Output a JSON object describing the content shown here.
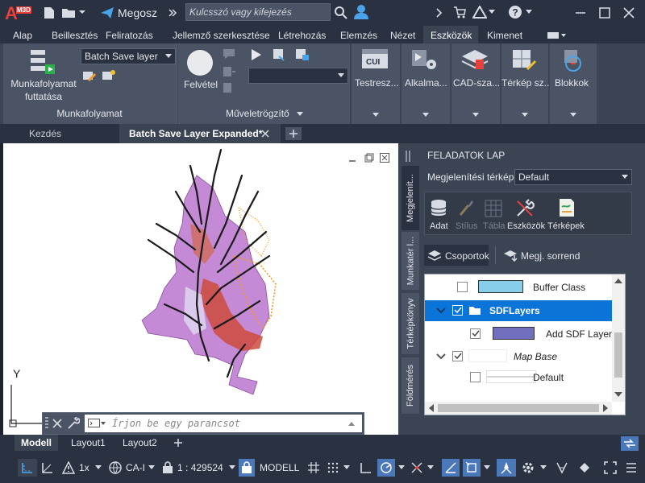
{
  "app": {
    "badge": "M3D",
    "title_letter": "A"
  },
  "titlebar": {
    "share_label": "Megosz",
    "search_placeholder": "Kulcsszó vagy kifejezés"
  },
  "ribbon_tabs": [
    {
      "label": "Alap"
    },
    {
      "label": "Beillesztés"
    },
    {
      "label": "Feliratozás"
    },
    {
      "label": "Jellemző szerkesztése"
    },
    {
      "label": "Létrehozás"
    },
    {
      "label": "Elemzés"
    },
    {
      "label": "Nézet"
    },
    {
      "label": "Eszközök",
      "active": true
    },
    {
      "label": "Kimenet"
    }
  ],
  "ribbon": {
    "workflow_run_label": "Munkafolyamat\nfuttatása",
    "workflow_select": "Batch Save layer",
    "workflow_panel": "Munkafolyamat",
    "record_label": "Felvétel",
    "recorder_panel": "Műveletrögzítő",
    "customize_label": "Testresz...",
    "cui_label": "CUI",
    "apps_label": "Alkalma...",
    "cad_label": "CAD-sza...",
    "mapsz_label": "Térkép sz...",
    "blocks_label": "Blokkok"
  },
  "doc_tabs": {
    "home": "Kezdés",
    "active": "Batch Save Layer Expanded*"
  },
  "command": {
    "placeholder": "Írjon be egy parancsot"
  },
  "axis": {
    "y_label": "Y"
  },
  "task_pane": {
    "title": "FELADATOK LAP",
    "map_label": "Megjelenítési térkép:",
    "map_value": "Default",
    "vtabs": [
      "Megjelenít...",
      "Munkatér l...",
      "Térképkönyv",
      "Földmérés"
    ],
    "tools": [
      {
        "label": "Adat",
        "enabled": true
      },
      {
        "label": "Stílus",
        "enabled": false
      },
      {
        "label": "Tábla",
        "enabled": false
      },
      {
        "label": "Eszközök",
        "enabled": true
      },
      {
        "label": "Térképek",
        "enabled": true
      }
    ],
    "groups_label": "Csoportok",
    "order_label": "Megj. sorrend",
    "layers": [
      {
        "name": "Buffer Class",
        "color": "#87ceeb",
        "checked": false
      },
      {
        "name": "SDFLayers",
        "selected": true,
        "checked": true
      },
      {
        "name": "Add SDF Layer",
        "color": "#6f6fbd",
        "checked": true
      },
      {
        "name": "Map Base",
        "checked": true
      },
      {
        "name": "Default",
        "checked": false
      }
    ]
  },
  "layout_tabs": [
    {
      "label": "Modell",
      "active": true
    },
    {
      "label": "Layout1"
    },
    {
      "label": "Layout2"
    }
  ],
  "status": {
    "scale_factor": "1x",
    "coord_sys": "CA-I",
    "scale": "1 : 429524",
    "model": "MODELL"
  },
  "colors": {
    "accent": "#0078d7",
    "map_purple": "#c58ad6",
    "map_orange": "#f29a1f",
    "map_red": "#cc4a3c"
  }
}
